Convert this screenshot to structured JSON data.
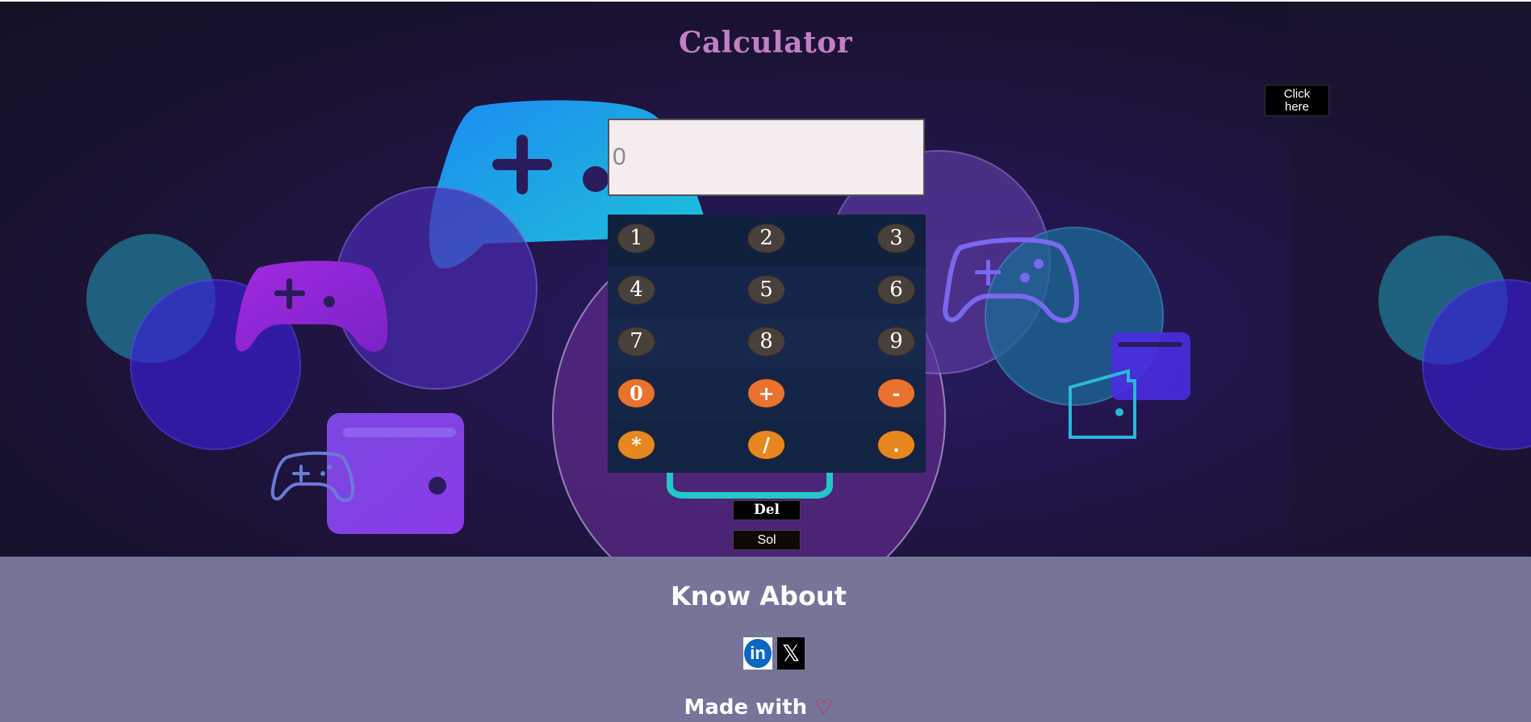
{
  "header": {
    "title": "Calculator"
  },
  "click_here_button": {
    "label": "Click here"
  },
  "display": {
    "placeholder": "0",
    "value": ""
  },
  "keypad": {
    "rows": [
      [
        "1",
        "2",
        "3"
      ],
      [
        "4",
        "5",
        "6"
      ],
      [
        "7",
        "8",
        "9"
      ],
      [
        "0",
        "+",
        "-"
      ],
      [
        "*",
        "/",
        "."
      ]
    ]
  },
  "actions": {
    "del_label": "Del",
    "sol_label": "Sol"
  },
  "footer": {
    "heading": "Know About",
    "linkedin_icon_text": "in",
    "x_icon_text": "𝕏",
    "made_with": "Made with",
    "heart": "♡"
  },
  "colors": {
    "title": "#c27fc4",
    "display_bg": "#f5ecee",
    "keypad_bg": "#142244",
    "number_key": "#4a403a",
    "operator_key": "#e8722e",
    "operator_key_2": "#e8871f",
    "footer_bg": "#757499",
    "linkedin_blue": "#0a66c2",
    "heart_red": "#e0202a"
  },
  "icons": {
    "background": [
      "gamepad-icon",
      "wallet-icon",
      "circle-bubbles"
    ],
    "social": [
      "linkedin-icon",
      "x-icon"
    ],
    "footer": [
      "heart-icon"
    ]
  }
}
